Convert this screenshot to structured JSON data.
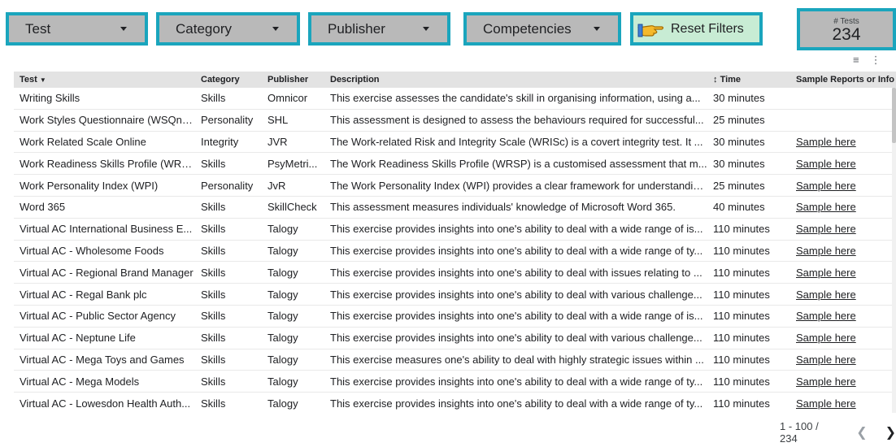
{
  "filters": [
    {
      "label": "Test"
    },
    {
      "label": "Category"
    },
    {
      "label": "Publisher"
    },
    {
      "label": "Competencies"
    }
  ],
  "reset_label": "Reset Filters",
  "scorecard": {
    "label": "# Tests",
    "value": "234"
  },
  "columns": [
    "Test",
    "Category",
    "Publisher",
    "Description",
    "Time",
    "Sample Reports or Info"
  ],
  "rows": [
    [
      "Writing Skills",
      "Skills",
      "Omnicor",
      "This exercise assesses the candidate's skill in organising information, using a...",
      "30 minutes",
      ""
    ],
    [
      "Work Styles Questionnaire (WSQn) ...",
      "Personality",
      "SHL",
      "This assessment is designed to assess the behaviours required for successful...",
      "25 minutes",
      ""
    ],
    [
      "Work Related Scale Online",
      "Integrity",
      "JVR",
      "The Work-related Risk and Integrity Scale (WRISc) is a covert integrity test. It ...",
      "30 minutes",
      "Sample here"
    ],
    [
      "Work Readiness Skills Profile (WRS...",
      "Skills",
      "PsyMetri...",
      "The Work Readiness Skills Profile (WRSP) is a customised assessment that m...",
      "30 minutes",
      "Sample here"
    ],
    [
      "Work Personality Index (WPI)",
      "Personality",
      "JvR",
      "The Work Personality Index (WPI) provides a clear framework for understandin...",
      "25 minutes",
      "Sample here"
    ],
    [
      "Word 365",
      "Skills",
      "SkillCheck",
      "This assessment measures individuals' knowledge of Microsoft Word 365.",
      "40 minutes",
      "Sample here"
    ],
    [
      "Virtual AC International Business E...",
      "Skills",
      "Talogy",
      "This exercise provides insights into one's ability to deal with a wide range of is...",
      "110 minutes",
      "Sample here"
    ],
    [
      "Virtual AC - Wholesome Foods",
      "Skills",
      "Talogy",
      "This exercise provides insights into one's ability to deal with a wide range of ty...",
      "110 minutes",
      "Sample here"
    ],
    [
      "Virtual AC - Regional Brand Manager",
      "Skills",
      "Talogy",
      "This exercise provides insights into one's ability to deal with issues relating to ...",
      "110 minutes",
      "Sample here"
    ],
    [
      "Virtual AC - Regal Bank plc",
      "Skills",
      "Talogy",
      "This exercise provides insights into one's ability to deal with various challenge...",
      "110 minutes",
      "Sample here"
    ],
    [
      "Virtual AC - Public Sector Agency",
      "Skills",
      "Talogy",
      "This exercise provides insights into one's ability to deal with a wide range of is...",
      "110 minutes",
      "Sample here"
    ],
    [
      "Virtual AC - Neptune Life",
      "Skills",
      "Talogy",
      "This exercise provides insights into one's ability to deal with various challenge...",
      "110 minutes",
      "Sample here"
    ],
    [
      "Virtual AC - Mega Toys and Games",
      "Skills",
      "Talogy",
      "This exercise measures one's ability to deal with highly strategic issues within ...",
      "110 minutes",
      "Sample here"
    ],
    [
      "Virtual AC - Mega Models",
      "Skills",
      "Talogy",
      "This exercise provides insights into one's ability to deal with a wide range of ty...",
      "110 minutes",
      "Sample here"
    ],
    [
      "Virtual AC - Lowesdon Health Auth...",
      "Skills",
      "Talogy",
      "This exercise provides insights into one's ability to deal with a wide range of ty...",
      "110 minutes",
      "Sample here"
    ]
  ],
  "pagination": "1 - 100 / 234",
  "icons": {
    "filter": "filter-lines-icon",
    "more": "more-vert-icon",
    "prev": "chevron-left-icon",
    "next": "chevron-right-icon",
    "hand": "pointing-hand-icon"
  },
  "colors": {
    "accent": "#1aa5bd",
    "control_bg": "#b9b9b9",
    "reset_bg": "#c8ecd4",
    "header_bg": "#e3e3e3"
  }
}
